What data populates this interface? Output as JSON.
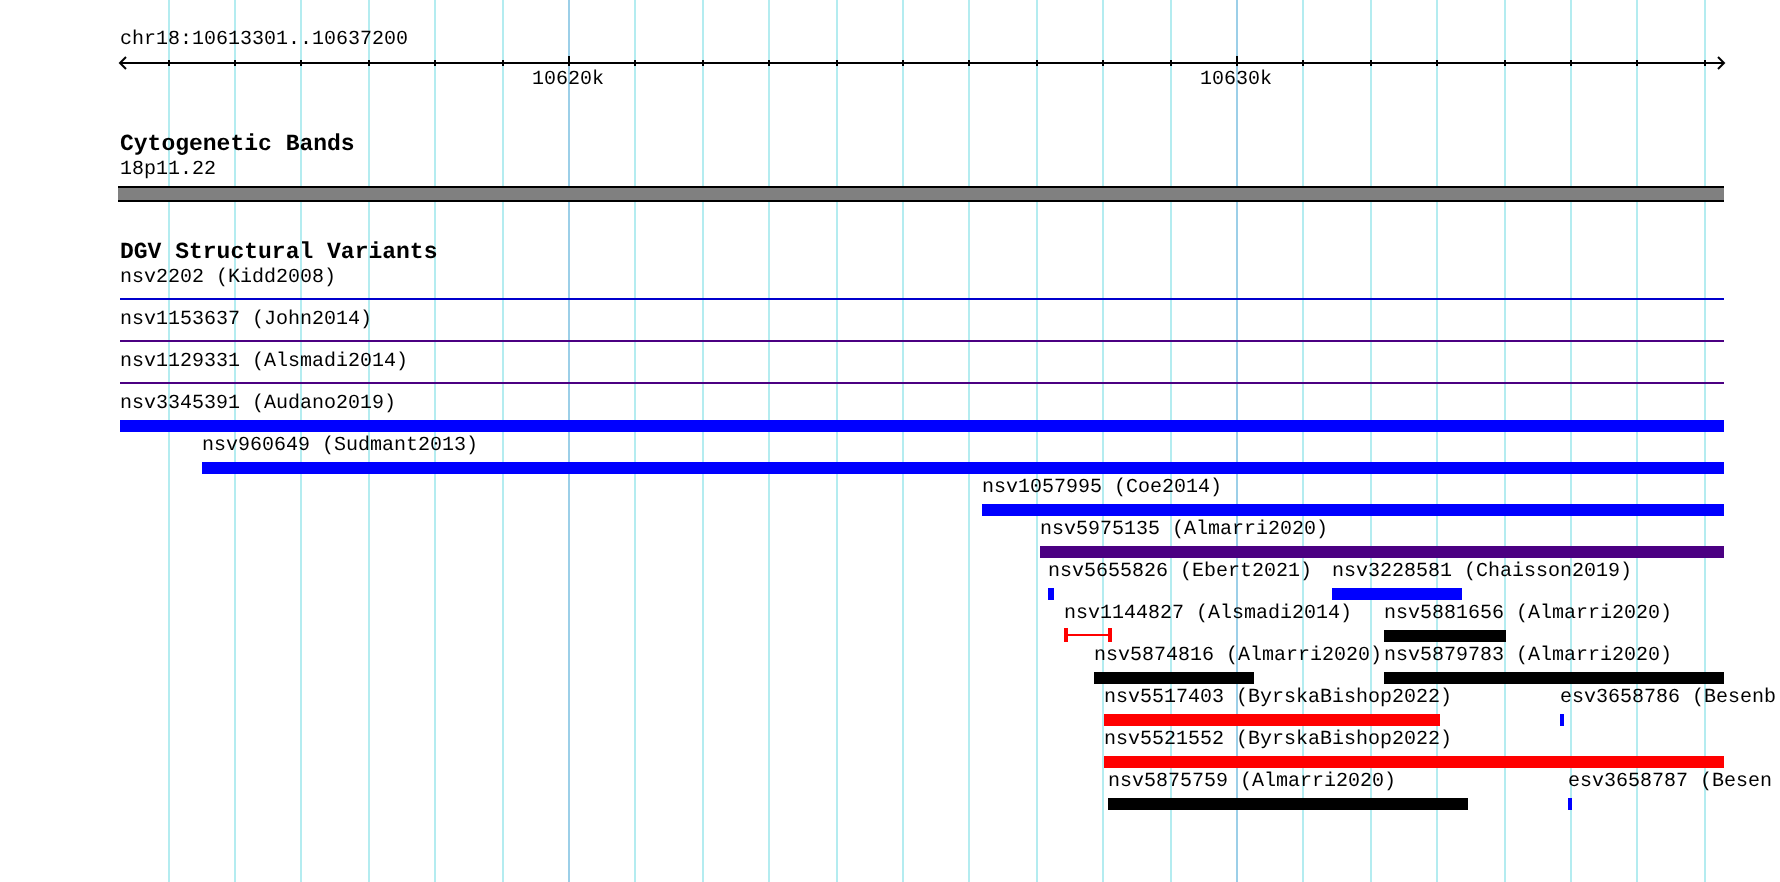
{
  "ruler": {
    "location": "chr18:10613301..10637200",
    "ticks": [
      {
        "label": "10620k"
      },
      {
        "label": "10630k"
      }
    ]
  },
  "cytoband_track": {
    "title": "Cytogenetic Bands",
    "band": "18p11.22"
  },
  "dgv_track": {
    "title": "DGV Structural Variants",
    "rows": [
      {
        "features": [
          {
            "label": "nsv2202 (Kidd2008)",
            "kind": "line",
            "color": "#0000cc"
          }
        ]
      },
      {
        "features": [
          {
            "label": "nsv1153637 (John2014)",
            "kind": "line",
            "color": "#4b0082"
          }
        ]
      },
      {
        "features": [
          {
            "label": "nsv1129331 (Alsmadi2014)",
            "kind": "line",
            "color": "#4b0082"
          }
        ]
      },
      {
        "features": [
          {
            "label": "nsv3345391 (Audano2019)",
            "kind": "bar",
            "color": "#0000ff"
          }
        ]
      },
      {
        "features": [
          {
            "label": "nsv960649 (Sudmant2013)",
            "kind": "bar",
            "color": "#0000ff"
          }
        ]
      },
      {
        "features": [
          {
            "label": "nsv1057995 (Coe2014)",
            "kind": "bar",
            "color": "#0000ff"
          }
        ]
      },
      {
        "features": [
          {
            "label": "nsv5975135 (Almarri2020)",
            "kind": "bar",
            "color": "#4b0082"
          }
        ]
      },
      {
        "features": [
          {
            "label": "nsv5655826 (Ebert2021)",
            "kind": "bar",
            "color": "#0000ff"
          },
          {
            "label": "nsv3228581 (Chaisson2019)",
            "kind": "bar",
            "color": "#0000ff"
          }
        ]
      },
      {
        "features": [
          {
            "label": "nsv1144827 (Alsmadi2014)",
            "kind": "interval",
            "color": "#ff0000"
          },
          {
            "label": "nsv5881656 (Almarri2020)",
            "kind": "bar",
            "color": "#000000"
          }
        ]
      },
      {
        "features": [
          {
            "label": "nsv5874816 (Almarri2020)",
            "kind": "bar",
            "color": "#000000"
          },
          {
            "label": "nsv5879783 (Almarri2020)",
            "kind": "bar",
            "color": "#000000"
          }
        ]
      },
      {
        "features": [
          {
            "label": "nsv5517403 (ByrskaBishop2022)",
            "kind": "bar",
            "color": "#ff0000"
          },
          {
            "label": "esv3658786 (Besenb",
            "kind": "bar",
            "color": "#0000ff"
          }
        ]
      },
      {
        "features": [
          {
            "label": "nsv5521552 (ByrskaBishop2022)",
            "kind": "bar",
            "color": "#ff0000"
          }
        ]
      },
      {
        "features": [
          {
            "label": "nsv5875759 (Almarri2020)",
            "kind": "bar",
            "color": "#000000"
          },
          {
            "label": "esv3658787 (Besen",
            "kind": "bar",
            "color": "#0000ff"
          }
        ]
      }
    ]
  }
}
